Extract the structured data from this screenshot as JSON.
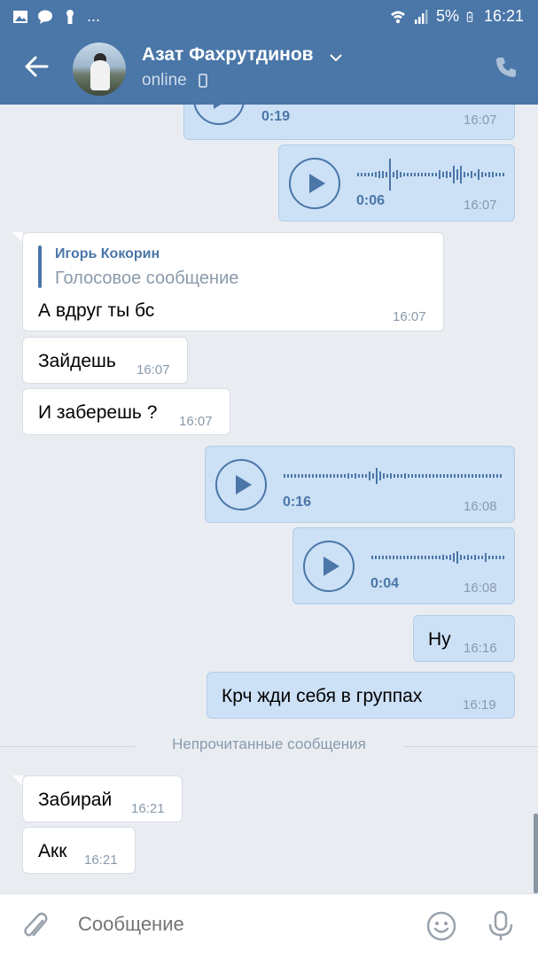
{
  "status_bar": {
    "battery": "5%",
    "time": "16:21",
    "dots": "..."
  },
  "header": {
    "name": "Азат Фахрутдинов",
    "status": "online"
  },
  "messages": [
    {
      "kind": "voice",
      "duration": "0:19",
      "time": "16:07"
    },
    {
      "kind": "voice",
      "duration": "0:06",
      "time": "16:07"
    },
    {
      "kind": "reply",
      "reply_author": "Игорь Кокорин",
      "reply_text": "Голосовое сообщение",
      "text": "А вдруг ты бс",
      "time": "16:07"
    },
    {
      "kind": "text",
      "text": "Зайдешь",
      "time": "16:07"
    },
    {
      "kind": "text",
      "text": "И заберешь ?",
      "time": "16:07"
    },
    {
      "kind": "voice",
      "duration": "0:16",
      "time": "16:08"
    },
    {
      "kind": "voice",
      "duration": "0:04",
      "time": "16:08"
    },
    {
      "kind": "text",
      "text": "Ну",
      "time": "16:16"
    },
    {
      "kind": "text",
      "text": "Крч жди себя в группах",
      "time": "16:19"
    },
    {
      "kind": "text",
      "text": "Забирай",
      "time": "16:21"
    },
    {
      "kind": "text",
      "text": "Акк",
      "time": "16:21"
    }
  ],
  "unread_divider": "Непрочитанные сообщения",
  "composer": {
    "placeholder": "Сообщение"
  },
  "colors": {
    "accent": "#4a76a8",
    "outgoing_bubble": "#cce0f6",
    "background": "#e9edf2"
  }
}
